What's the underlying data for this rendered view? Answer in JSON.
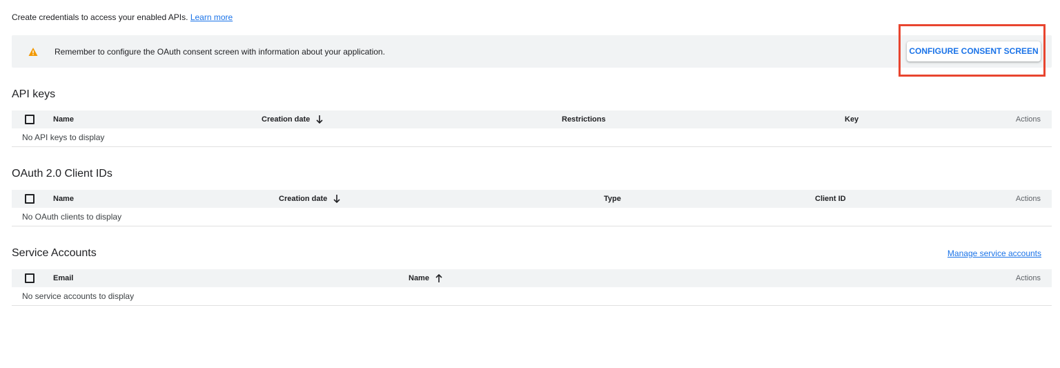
{
  "intro": {
    "text": "Create credentials to access your enabled APIs.",
    "link": "Learn more"
  },
  "banner": {
    "icon": "warning-icon",
    "message": "Remember to configure the OAuth consent screen with information about your application.",
    "button": "CONFIGURE CONSENT SCREEN"
  },
  "api_keys": {
    "title": "API keys",
    "columns": [
      "Name",
      "Creation date",
      "Restrictions",
      "Key",
      "Actions"
    ],
    "sort_column": "Creation date",
    "sort_direction": "down",
    "empty": "No API keys to display"
  },
  "oauth": {
    "title": "OAuth 2.0 Client IDs",
    "columns": [
      "Name",
      "Creation date",
      "Type",
      "Client ID",
      "Actions"
    ],
    "sort_column": "Creation date",
    "sort_direction": "down",
    "empty": "No OAuth clients to display"
  },
  "service_accounts": {
    "title": "Service Accounts",
    "manage_link": "Manage service accounts",
    "columns": [
      "Email",
      "Name",
      "Actions"
    ],
    "sort_column": "Name",
    "sort_direction": "up",
    "empty": "No service accounts to display"
  },
  "colors": {
    "accent": "#1a73e8",
    "warning": "#f29900",
    "highlight": "#e8452f",
    "header_bg": "#f1f3f4"
  }
}
